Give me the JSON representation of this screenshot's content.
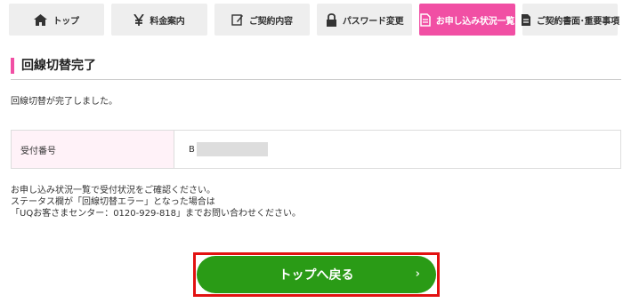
{
  "nav": {
    "items": [
      {
        "label": "トップ",
        "icon": "home-icon",
        "active": false
      },
      {
        "label": "料金案内",
        "icon": "yen-icon",
        "active": false
      },
      {
        "label": "ご契約内容",
        "icon": "edit-icon",
        "active": false
      },
      {
        "label": "パスワード変更",
        "icon": "lock-icon",
        "active": false
      },
      {
        "label": "お申し込み状況一覧",
        "icon": "document-icon",
        "active": true
      },
      {
        "label": "ご契約書面･重要事項",
        "icon": "document-icon",
        "active": false
      }
    ],
    "active_color": "#f14fa4",
    "inactive_color": "#eeeeee"
  },
  "page": {
    "title": "回線切替完了",
    "message": "回線切替が完了しました。",
    "info": {
      "label": "受付番号",
      "value_prefix": "B"
    },
    "notes": [
      "お申し込み状況一覧で受付状況をご確認ください。",
      "ステータス欄が「回線切替エラー」となった場合は",
      "「UQお客さまセンター：0120-929-818」までお問い合わせください。"
    ]
  },
  "actions": {
    "back_to_top": "トップへ戻る",
    "chevron": "›"
  },
  "colors": {
    "accent": "#f14fa4",
    "button": "#2a9b16",
    "highlight": "#e21111"
  }
}
